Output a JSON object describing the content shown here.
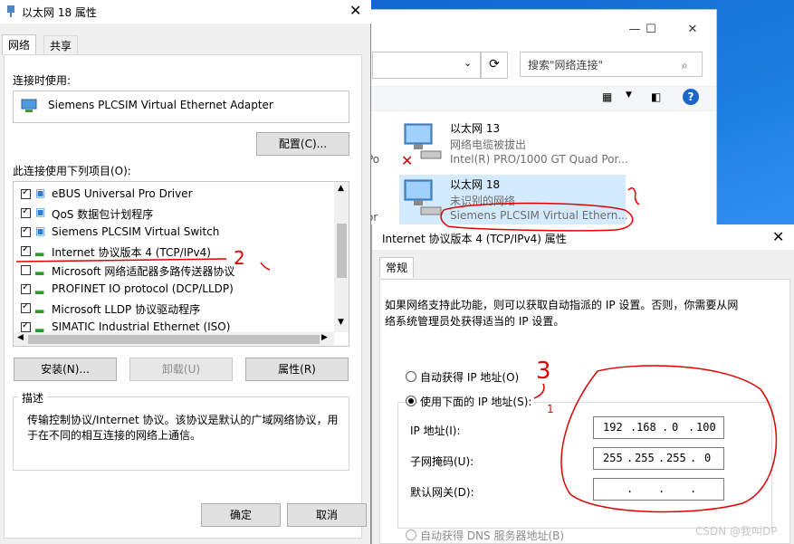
{
  "explorer": {
    "search_placeholder": "搜索\"网络连接\"",
    "connections": [
      {
        "name": "以太网 13",
        "status": "网络电缆被拔出",
        "adapter": "Intel(R) PRO/1000 GT Quad Por..."
      },
      {
        "name": "以太网 18",
        "status": "未识别的网络",
        "adapter": "Siemens PLCSIM Virtual Ethern..."
      }
    ],
    "partial_left_1": "Po",
    "partial_left_2": "or"
  },
  "dialog1": {
    "title": "以太网 18 属性",
    "tabs": [
      "网络",
      "共享"
    ],
    "connect_using_label": "连接时使用:",
    "adapter_name": "Siemens PLCSIM Virtual Ethernet Adapter",
    "configure_button": "配置(C)...",
    "items_label": "此连接使用下列项目(O):",
    "items": [
      {
        "label": "eBUS Universal Pro Driver",
        "checked": true
      },
      {
        "label": "QoS 数据包计划程序",
        "checked": true
      },
      {
        "label": "Siemens PLCSIM Virtual Switch",
        "checked": true
      },
      {
        "label": "Internet 协议版本 4 (TCP/IPv4)",
        "checked": true
      },
      {
        "label": "Microsoft 网络适配器多路传送器协议",
        "checked": false
      },
      {
        "label": "PROFINET IO protocol (DCP/LLDP)",
        "checked": true
      },
      {
        "label": "Microsoft LLDP 协议驱动程序",
        "checked": true
      },
      {
        "label": "SIMATIC Industrial Ethernet (ISO)",
        "checked": true
      }
    ],
    "install_button": "安装(N)...",
    "uninstall_button": "卸载(U)",
    "properties_button": "属性(R)",
    "description_label": "描述",
    "description_text_1": "传输控制协议/Internet 协议。该协议是默认的广域网络协议，用",
    "description_text_2": "于在不同的相互连接的网络上通信。",
    "ok_button": "确定",
    "cancel_button": "取消"
  },
  "dialog2": {
    "title": "Internet 协议版本 4 (TCP/IPv4) 属性",
    "tab": "常规",
    "info_1": "如果网络支持此功能，则可以获取自动指派的 IP 设置。否则，你需要从网",
    "info_2": "络系统管理员处获得适当的 IP 设置。",
    "auto_ip_label": "自动获得 IP 地址(O)",
    "manual_ip_label": "使用下面的 IP 地址(S):",
    "ip_label": "IP 地址(I):",
    "mask_label": "子网掩码(U):",
    "gateway_label": "默认网关(D):",
    "ip": [
      "192",
      "168",
      "0",
      "100"
    ],
    "mask": [
      "255",
      "255",
      "255",
      "0"
    ],
    "gateway": [
      "",
      "",
      "",
      ""
    ],
    "auto_dns_label": "自动获得 DNS 服务器地址(B)"
  },
  "watermark": "CSDN @我叫DP",
  "annotation_marks": [
    "2",
    "3",
    "1"
  ]
}
